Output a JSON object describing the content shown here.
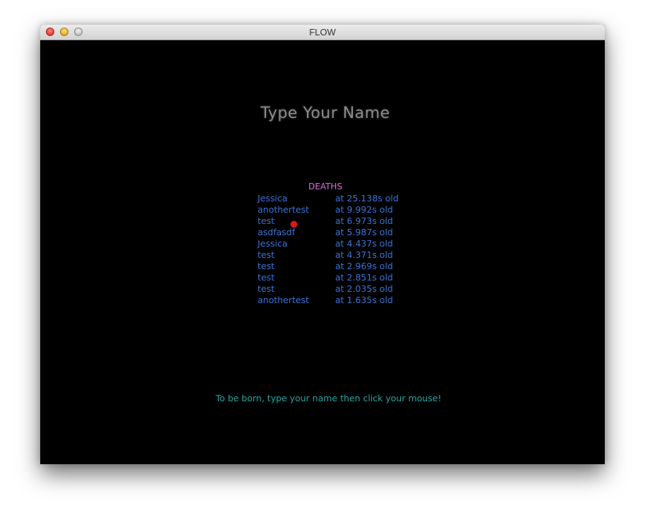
{
  "window": {
    "title": "FLOW"
  },
  "game": {
    "name_prompt": "Type Your Name",
    "deaths_header": "DEATHS",
    "deaths": [
      {
        "name": "Jessica",
        "age": "at 25.138s old"
      },
      {
        "name": "anothertest",
        "age": "at 9.992s old"
      },
      {
        "name": "test",
        "age": "at 6.973s old"
      },
      {
        "name": "asdfasdf",
        "age": "at 5.987s old"
      },
      {
        "name": "Jessica",
        "age": "at 4.437s old"
      },
      {
        "name": "test",
        "age": "at 4.371s old"
      },
      {
        "name": "test",
        "age": "at 2.969s old"
      },
      {
        "name": "test",
        "age": "at 2.851s old"
      },
      {
        "name": "test",
        "age": "at 2.035s old"
      },
      {
        "name": "anothertest",
        "age": "at 1.635s old"
      }
    ],
    "instruction": "To be born, type your name then click your mouse!"
  },
  "colors": {
    "background": "#000000",
    "prompt": "#8a8a8a",
    "deaths_header": "#d96fd9",
    "deaths_text": "#3b73d6",
    "instruction": "#22a6a6",
    "cursor": "#d81c1c"
  }
}
